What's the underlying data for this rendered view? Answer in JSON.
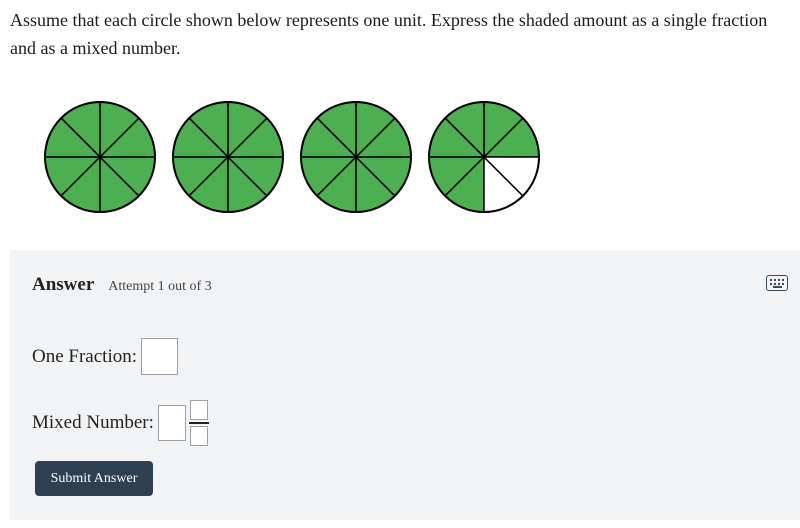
{
  "question": {
    "text": "Assume that each circle shown below represents one unit. Express the shaded amount as a single fraction and as a mixed number."
  },
  "figure": {
    "parts_per_circle": 8,
    "circles": [
      {
        "shaded_parts": 8
      },
      {
        "shaded_parts": 8
      },
      {
        "shaded_parts": 8
      },
      {
        "shaded_parts": 6
      }
    ],
    "colors": {
      "shaded": "#4caf50",
      "unshaded": "#ffffff",
      "outline": "#000000"
    }
  },
  "answer": {
    "title": "Answer",
    "attempt": "Attempt 1 out of 3",
    "keyboard_icon": "keyboard-icon",
    "one_fraction_label": "One Fraction:",
    "one_fraction_value": "",
    "mixed_number_label": "Mixed Number:",
    "mixed_whole_value": "",
    "mixed_numerator_value": "",
    "mixed_denominator_value": "",
    "submit_label": "Submit Answer"
  }
}
